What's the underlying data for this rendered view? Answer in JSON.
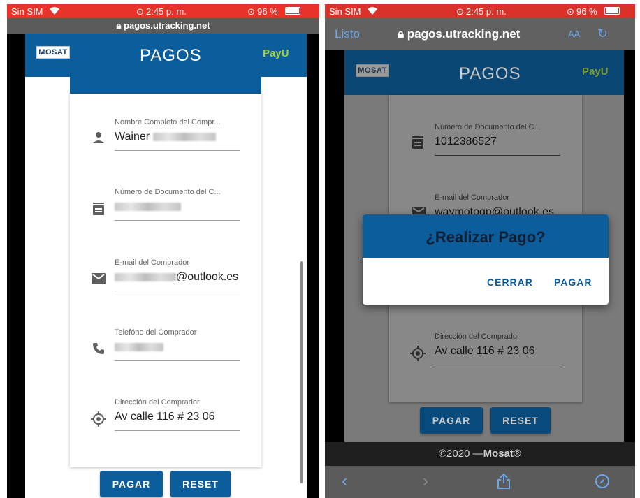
{
  "left": {
    "status": {
      "carrier": "Sin SIM",
      "time": "2:45 p. m.",
      "battery": "96 %"
    },
    "url": "pagos.utracking.net",
    "app": {
      "logo": "MOSAT",
      "title": "PAGOS",
      "payu": "PayU"
    },
    "fields": [
      {
        "label": "Nombre Completo del Compr...",
        "value": "Wainer",
        "icon": "person-icon"
      },
      {
        "label": "Número de Documento del C...",
        "value": "",
        "icon": "id-card-icon"
      },
      {
        "label": "E-mail del Comprador",
        "value": "@outlook.es",
        "icon": "email-icon"
      },
      {
        "label": "Telefóno del Comprador",
        "value": "",
        "icon": "phone-icon"
      },
      {
        "label": "Dirección del Comprador",
        "value": "Av calle 116 # 23 06",
        "icon": "location-icon"
      }
    ],
    "buttons": {
      "pay": "PAGAR",
      "reset": "RESET"
    }
  },
  "right": {
    "status": {
      "carrier": "Sin SIM",
      "time": "2:45 p. m.",
      "battery": "96 %"
    },
    "browser": {
      "done": "Listo",
      "url": "pagos.utracking.net",
      "text_size": "AA"
    },
    "app": {
      "logo": "MOSAT",
      "title": "PAGOS",
      "payu": "PayU"
    },
    "fields": [
      {
        "label": "Número de Documento del C...",
        "value": "1012386527",
        "icon": "id-card-icon"
      },
      {
        "label": "E-mail del Comprador",
        "value": "waymotoqp@outlook.es",
        "icon": "email-icon"
      },
      {
        "label": "Dirección del Comprador",
        "value": "Av calle 116 # 23 06",
        "icon": "location-icon"
      }
    ],
    "dialog": {
      "title": "¿Realizar Pago?",
      "close": "CERRAR",
      "pay": "PAGAR"
    },
    "buttons": {
      "pay": "PAGAR",
      "reset": "RESET"
    },
    "footer": {
      "year": "©2020 —",
      "brand": "Mosat®"
    }
  },
  "colors": {
    "brand": "#0b5d9c",
    "status_bar": "#e8332b",
    "payu": "#a7cf3a"
  }
}
